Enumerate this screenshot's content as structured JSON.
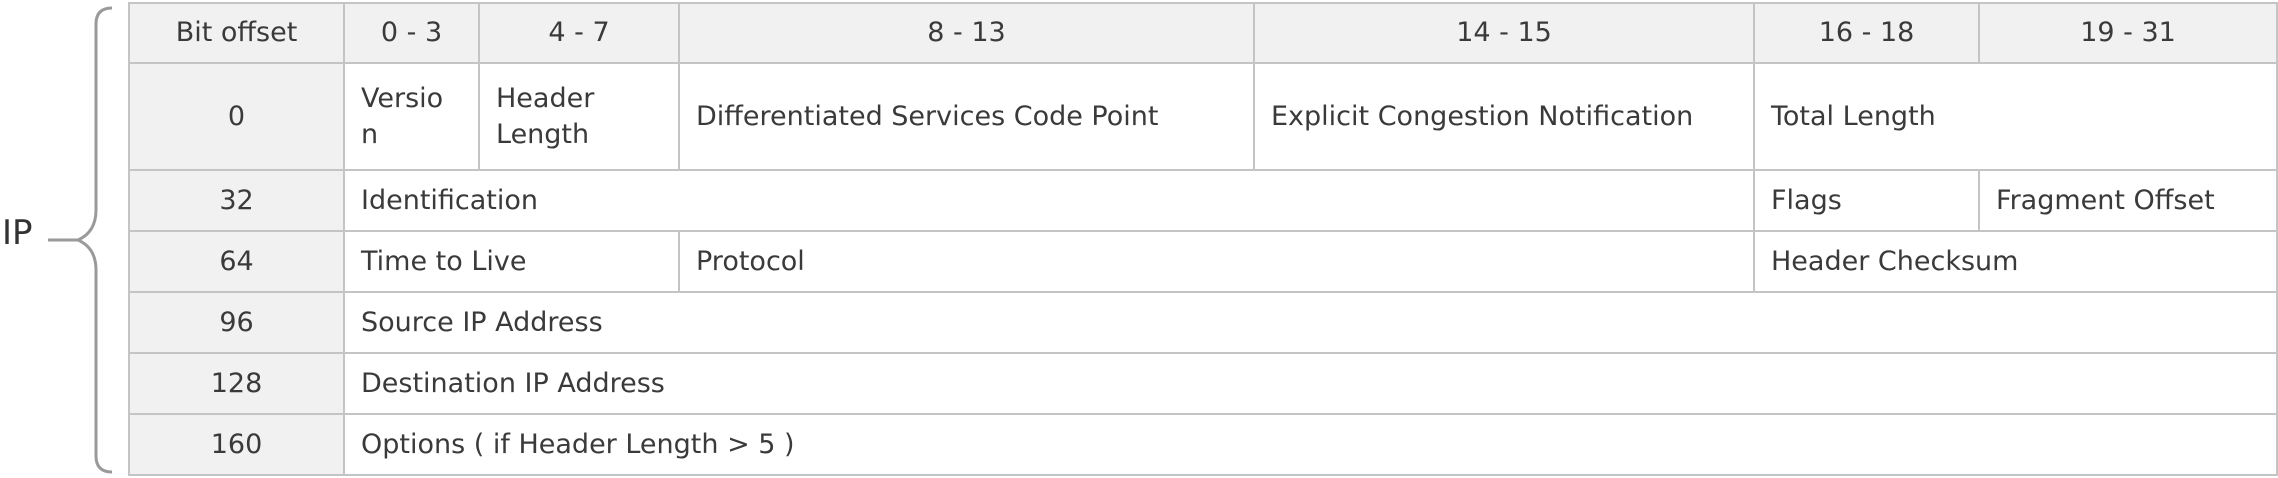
{
  "diagram": {
    "side_label": "IP",
    "header": {
      "bit_offset": "Bit offset",
      "ranges": [
        "0 - 3",
        "4 - 7",
        "8 - 13",
        "14 - 15",
        "16 - 18",
        "19 - 31"
      ]
    },
    "rows": [
      {
        "offset": "0",
        "fields": [
          "Versio n",
          "Header Length",
          "Differentiated Services Code Point",
          "Explicit Congestion Notification",
          "Total Length"
        ]
      },
      {
        "offset": "32",
        "fields": [
          "Identification",
          "Flags",
          "Fragment Offset"
        ]
      },
      {
        "offset": "64",
        "fields": [
          "Time to Live",
          "Protocol",
          "Header Checksum"
        ]
      },
      {
        "offset": "96",
        "fields": [
          "Source IP Address"
        ]
      },
      {
        "offset": "128",
        "fields": [
          "Destination IP Address"
        ]
      },
      {
        "offset": "160",
        "fields": [
          "Options ( if Header Length > 5 )"
        ]
      }
    ]
  }
}
